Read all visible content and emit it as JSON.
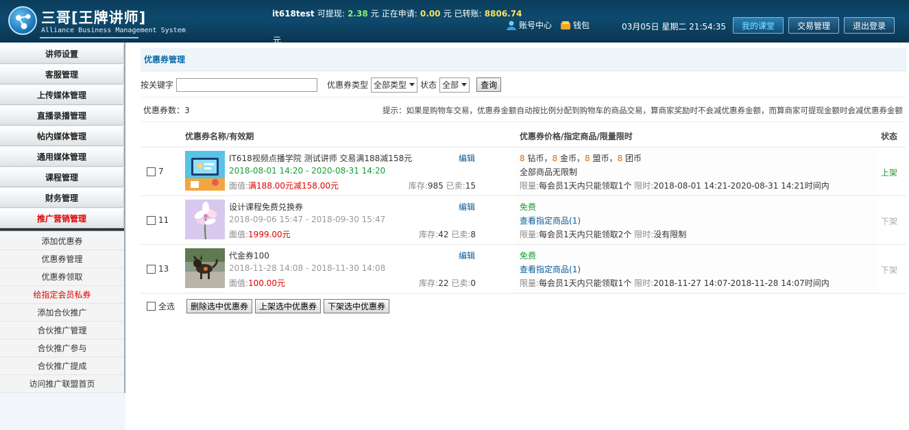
{
  "header": {
    "brand_title": "三哥[王牌讲师]",
    "brand_subtitle": "Alliance Business Management System",
    "user": "it618test",
    "withdrawable_label": "可提现:",
    "withdrawable": "2.38",
    "applying_label": "元 正在申请:",
    "applying": "0.00",
    "transferred_label": "元 已转账:",
    "transferred": "8806.74",
    "currency_tail": "元",
    "account_link": "账号中心",
    "wallet_link": "钱包",
    "clock": "03月05日 星期二 21:54:35",
    "btn_my_class": "我的课堂",
    "btn_trade": "交易管理",
    "btn_logout": "退出登录"
  },
  "sidebar": {
    "menu": [
      {
        "label": "讲师设置"
      },
      {
        "label": "客服管理"
      },
      {
        "label": "上传媒体管理"
      },
      {
        "label": "直播录播管理"
      },
      {
        "label": "帖内媒体管理"
      },
      {
        "label": "通用媒体管理"
      },
      {
        "label": "课程管理"
      },
      {
        "label": "财务管理"
      },
      {
        "label": "推广营销管理"
      }
    ],
    "submenu": [
      {
        "label": "添加优惠券"
      },
      {
        "label": "优惠券管理"
      },
      {
        "label": "优惠券领取"
      },
      {
        "label": "给指定会员私券"
      },
      {
        "label": "添加合伙推广"
      },
      {
        "label": "合伙推广管理"
      },
      {
        "label": "合伙推广参与"
      },
      {
        "label": "合伙推广提成"
      },
      {
        "label": "访问推广联盟首页"
      }
    ]
  },
  "page": {
    "title": "优惠券管理",
    "keyword_label": "按关键字",
    "type_label": "优惠券类型",
    "type_value": "全部类型",
    "status_label": "状态",
    "status_value": "全部",
    "query_button": "查询",
    "count_label": "优惠券数：",
    "count": "3",
    "hint": "提示：如果是购物车交易，优惠券金额自动按比例分配到购物车的商品交易，算商家奖励时不会减优惠券金额，而算商家可提现金额时会减优惠券金额"
  },
  "table": {
    "col_name": "优惠券名称/有效期",
    "col_price": "优惠券价格/指定商品/限量限时",
    "col_status": "状态",
    "rows": [
      {
        "id": "7",
        "name": "IT618视频点播学院 测试讲师 交易满188减158元",
        "edit": "编辑",
        "dates": "2018-08-01 14:20 - 2020-08-31 14:20",
        "face_label": "面值:",
        "face_value": "满188.00元减158.00元",
        "stock_label": "库存:",
        "stock": "985",
        "sold_label": "已卖:",
        "sold": "15",
        "price": {
          "n1": "8",
          "u1": "钻币，",
          "n2": "8",
          "u2": "金币，",
          "n3": "8",
          "u3": "盟币，",
          "n4": "8",
          "u4": "团币"
        },
        "goods": "全部商品无限制",
        "limit_label": "限量:",
        "limit_text": "每会员1天内只能领取1个",
        "time_label": "限时:",
        "time_text": "2018-08-01 14:21-2020-08-31 14:21时间内",
        "status": "上架"
      },
      {
        "id": "11",
        "name": "设计课程免费兑换券",
        "edit": "编辑",
        "dates": "2018-09-06 15:47 - 2018-09-30 15:47",
        "face_label": "面值:",
        "face_value": "1999.00元",
        "stock_label": "库存:",
        "stock": "42",
        "sold_label": "已卖:",
        "sold": "8",
        "price_free": "免费",
        "goods_link": "查看指定商品",
        "goods_count": "1",
        "limit_label": "限量:",
        "limit_text": "每会员1天内只能领取2个",
        "time_label": "限时:",
        "time_text": "没有限制",
        "status": "下架"
      },
      {
        "id": "13",
        "name": "代金券100",
        "edit": "编辑",
        "dates": "2018-11-28 14:08 - 2018-11-30 14:08",
        "face_label": "面值:",
        "face_value": "100.00元",
        "stock_label": "库存:",
        "stock": "22",
        "sold_label": "已卖:",
        "sold": "0",
        "price_free": "免费",
        "goods_link": "查看指定商品",
        "goods_count": "1",
        "limit_label": "限量:",
        "limit_text": "每会员1天内只能领取1个",
        "time_label": "限时:",
        "time_text": "2018-11-27 14:07-2018-11-28 14:07时间内",
        "status": "下架"
      }
    ],
    "select_all": "全选",
    "btn_delete": "删除选中优惠券",
    "btn_on": "上架选中优惠券",
    "btn_off": "下架选中优惠券"
  }
}
